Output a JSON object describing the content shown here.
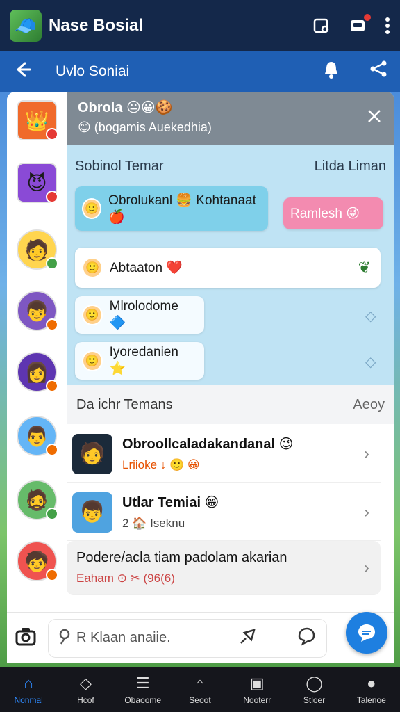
{
  "appbar": {
    "title": "Nase Bosial",
    "logo_icon": "game-avatar",
    "actions": [
      {
        "name": "card-icon",
        "glyph": "▭"
      },
      {
        "name": "inbox-icon",
        "glyph": "🖂"
      },
      {
        "name": "more-vert-icon",
        "glyph": "⋮"
      }
    ]
  },
  "subbar": {
    "title": "Uvlo Soniai",
    "back_icon": "arrow-left-icon",
    "bell_icon": "bell-icon",
    "share_icon": "share-icon"
  },
  "chat": {
    "title": "Obrola 😐😀🍪",
    "subtitle": "😊 (bogamis Auekedhia)",
    "section_left": "Sobinol Temar",
    "section_right": "Litda Liman",
    "bubbles": [
      {
        "text": "Obrolukanl 🍔 Kohtanaat🍎",
        "avatar": "🙂"
      },
      {
        "text": "Ramlesh 😜",
        "avatar": ""
      },
      {
        "text": "Abtaaton ❤️",
        "avatar": "🙂"
      },
      {
        "text": "Mlrolodome 🔷",
        "avatar": "🙂"
      },
      {
        "text": "Iyoredanien ⭐",
        "avatar": "🙂"
      }
    ]
  },
  "list_section": {
    "title": "Da ichr Temans",
    "right": "Aeoy"
  },
  "list_items": [
    {
      "title": "Obroollcaladakandanal 😉",
      "subtitle": "Lriioke ↓ 🙂 😀",
      "thumb": "🧑"
    },
    {
      "title": "Utlar Temiai 😁",
      "subtitle": "2 🏠 Iseknu",
      "thumb": "👦"
    },
    {
      "title": "Podere/acla tiam padolam akarian",
      "subtitle": "Eaham ⊙ ✂ (96(6)",
      "thumb": ""
    }
  ],
  "search": {
    "placeholder": "R Klaan anaiie."
  },
  "bottom_nav": [
    {
      "label": "Nonmal",
      "icon": "home-icon",
      "glyph": "⌂",
      "active": true
    },
    {
      "label": "Hcof",
      "icon": "diamond-icon",
      "glyph": "◇",
      "active": false
    },
    {
      "label": "Obaoome",
      "icon": "list-icon",
      "glyph": "☰",
      "active": false
    },
    {
      "label": "Seoot",
      "icon": "house-icon",
      "glyph": "⌂",
      "active": false
    },
    {
      "label": "Nooterr",
      "icon": "image-icon",
      "glyph": "▣",
      "active": false
    },
    {
      "label": "Stloer",
      "icon": "chat-icon",
      "glyph": "◯",
      "active": false
    },
    {
      "label": "Talenoe",
      "icon": "person-icon",
      "glyph": "●",
      "active": false
    }
  ]
}
